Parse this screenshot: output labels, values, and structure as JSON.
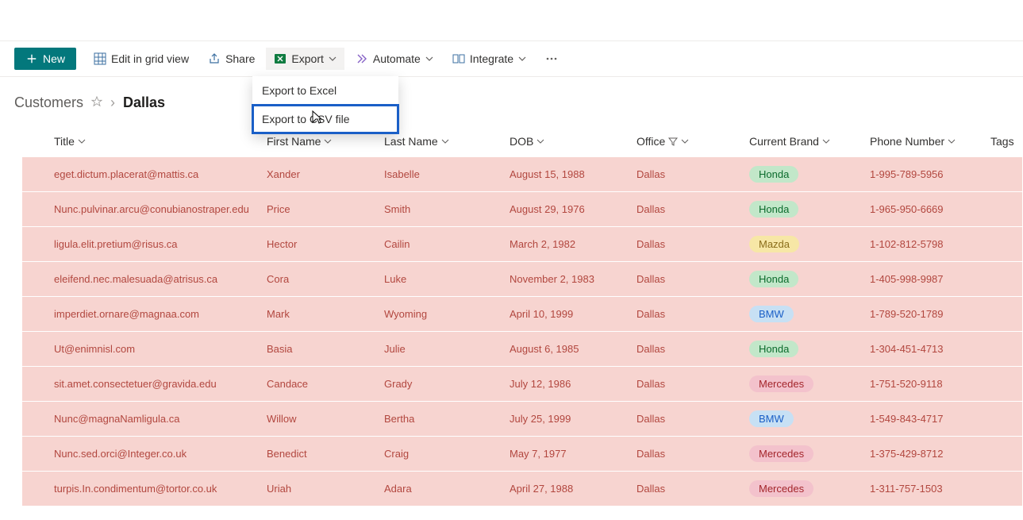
{
  "toolbar": {
    "new_label": "New",
    "edit_grid_label": "Edit in grid view",
    "share_label": "Share",
    "export_label": "Export",
    "automate_label": "Automate",
    "integrate_label": "Integrate"
  },
  "export_menu": {
    "excel": "Export to Excel",
    "csv": "Export to CSV file"
  },
  "breadcrumb": {
    "list": "Customers",
    "view": "Dallas"
  },
  "columns": {
    "title": "Title",
    "first_name": "First Name",
    "last_name": "Last Name",
    "dob": "DOB",
    "office": "Office",
    "brand": "Current Brand",
    "phone": "Phone Number",
    "tags": "Tags"
  },
  "rows": [
    {
      "title": "eget.dictum.placerat@mattis.ca",
      "first": "Xander",
      "last": "Isabelle",
      "dob": "August 15, 1988",
      "office": "Dallas",
      "brand": "Honda",
      "phone": "1-995-789-5956"
    },
    {
      "title": "Nunc.pulvinar.arcu@conubianostraper.edu",
      "first": "Price",
      "last": "Smith",
      "dob": "August 29, 1976",
      "office": "Dallas",
      "brand": "Honda",
      "phone": "1-965-950-6669"
    },
    {
      "title": "ligula.elit.pretium@risus.ca",
      "first": "Hector",
      "last": "Cailin",
      "dob": "March 2, 1982",
      "office": "Dallas",
      "brand": "Mazda",
      "phone": "1-102-812-5798"
    },
    {
      "title": "eleifend.nec.malesuada@atrisus.ca",
      "first": "Cora",
      "last": "Luke",
      "dob": "November 2, 1983",
      "office": "Dallas",
      "brand": "Honda",
      "phone": "1-405-998-9987"
    },
    {
      "title": "imperdiet.ornare@magnaa.com",
      "first": "Mark",
      "last": "Wyoming",
      "dob": "April 10, 1999",
      "office": "Dallas",
      "brand": "BMW",
      "phone": "1-789-520-1789"
    },
    {
      "title": "Ut@enimnisl.com",
      "first": "Basia",
      "last": "Julie",
      "dob": "August 6, 1985",
      "office": "Dallas",
      "brand": "Honda",
      "phone": "1-304-451-4713"
    },
    {
      "title": "sit.amet.consectetuer@gravida.edu",
      "first": "Candace",
      "last": "Grady",
      "dob": "July 12, 1986",
      "office": "Dallas",
      "brand": "Mercedes",
      "phone": "1-751-520-9118"
    },
    {
      "title": "Nunc@magnaNamligula.ca",
      "first": "Willow",
      "last": "Bertha",
      "dob": "July 25, 1999",
      "office": "Dallas",
      "brand": "BMW",
      "phone": "1-549-843-4717"
    },
    {
      "title": "Nunc.sed.orci@Integer.co.uk",
      "first": "Benedict",
      "last": "Craig",
      "dob": "May 7, 1977",
      "office": "Dallas",
      "brand": "Mercedes",
      "phone": "1-375-429-8712"
    },
    {
      "title": "turpis.In.condimentum@tortor.co.uk",
      "first": "Uriah",
      "last": "Adara",
      "dob": "April 27, 1988",
      "office": "Dallas",
      "brand": "Mercedes",
      "phone": "1-311-757-1503"
    }
  ]
}
